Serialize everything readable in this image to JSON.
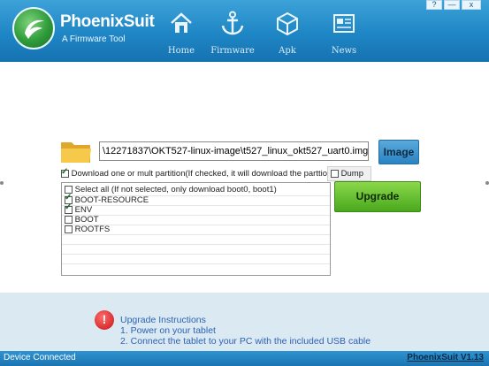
{
  "header": {
    "brand": "PhoenixSuit",
    "tagline": "A Firmware Tool",
    "nav": [
      {
        "label": "Home",
        "icon": "home-icon"
      },
      {
        "label": "Firmware",
        "icon": "anchor-icon"
      },
      {
        "label": "Apk",
        "icon": "cube-icon"
      },
      {
        "label": "News",
        "icon": "news-icon"
      }
    ],
    "window_buttons": [
      "?",
      "—",
      "x"
    ]
  },
  "firmware": {
    "path_value": "\\12271837\\OKT527-linux-image\\t527_linux_okt527_uart0.img",
    "image_button": "Image",
    "partition_option": {
      "checked": true,
      "label": "Download one or mult partition(If checked, it will download the parttions th"
    },
    "dump": {
      "checked": false,
      "label": "Dump"
    },
    "partitions": [
      {
        "label": "Select all (If not selected, only download boot0, boot1)",
        "checked": false
      },
      {
        "label": "BOOT-RESOURCE",
        "checked": true
      },
      {
        "label": "ENV",
        "checked": true
      },
      {
        "label": "BOOT",
        "checked": false
      },
      {
        "label": "ROOTFS",
        "checked": false
      }
    ],
    "upgrade_button": "Upgrade"
  },
  "instructions": {
    "title": "Upgrade Instructions",
    "steps": [
      "1. Power on your tablet",
      "2. Connect the tablet to your PC with the included USB cable"
    ]
  },
  "status": {
    "left": "Device Connected",
    "right": "PhoenixSuit V1.13"
  },
  "colors": {
    "header": "#1f86c5",
    "accent_green": "#4aa81e",
    "link_blue": "#2c63b4"
  }
}
